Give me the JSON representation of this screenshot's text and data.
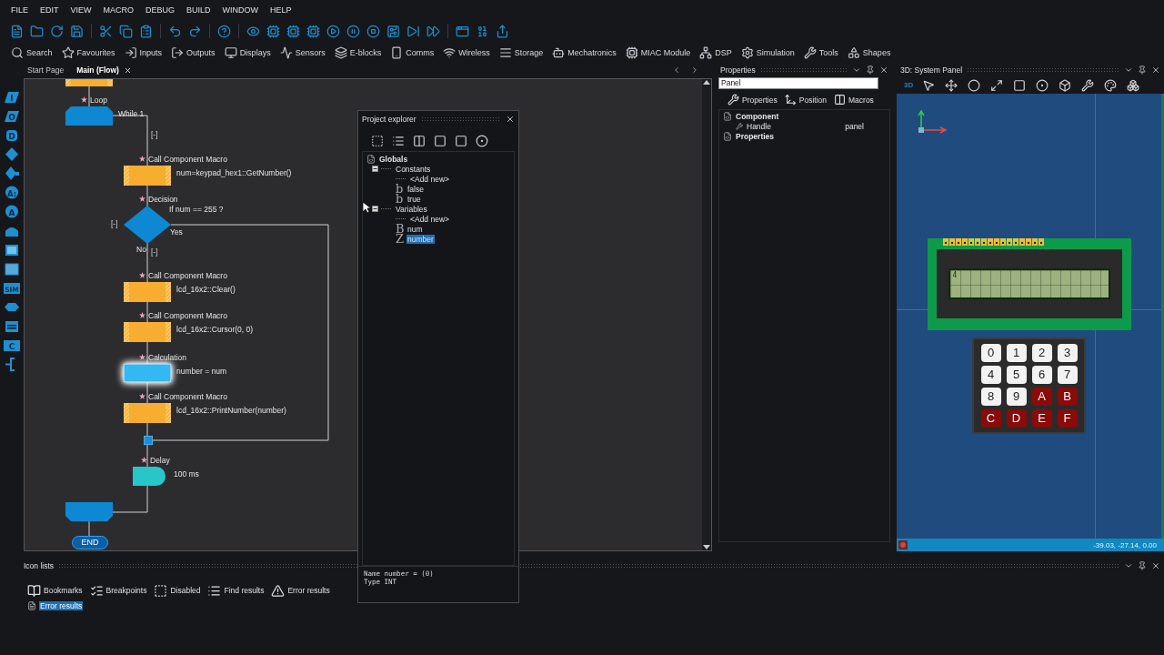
{
  "menu": [
    "FILE",
    "EDIT",
    "VIEW",
    "MACRO",
    "DEBUG",
    "BUILD",
    "WINDOW",
    "HELP"
  ],
  "component_toolbar": [
    {
      "label": "Search"
    },
    {
      "label": "Favourites"
    },
    {
      "label": "Inputs"
    },
    {
      "label": "Outputs"
    },
    {
      "label": "Displays"
    },
    {
      "label": "Sensors"
    },
    {
      "label": "E-blocks"
    },
    {
      "label": "Comms"
    },
    {
      "label": "Wireless"
    },
    {
      "label": "Storage"
    },
    {
      "label": "Mechatronics"
    },
    {
      "label": "MIAC Module"
    },
    {
      "label": "DSP"
    },
    {
      "label": "Simulation"
    },
    {
      "label": "Tools"
    },
    {
      "label": "Shapes"
    }
  ],
  "doc_tabs": [
    {
      "label": "Start Page",
      "selected": false
    },
    {
      "label": "Main (Flow)",
      "selected": true
    }
  ],
  "palette": [
    {
      "kind": "para",
      "glyph": "I"
    },
    {
      "kind": "para",
      "glyph": "O"
    },
    {
      "kind": "round",
      "glyph": "D"
    },
    {
      "kind": "diamond"
    },
    {
      "kind": "diamond_tail"
    },
    {
      "kind": "circle",
      "glyph": "A:"
    },
    {
      "kind": "circle",
      "glyph": "A"
    },
    {
      "kind": "dome"
    },
    {
      "kind": "bars"
    },
    {
      "kind": "hatched"
    },
    {
      "kind": "rect",
      "glyph": "SIM"
    },
    {
      "kind": "hex"
    },
    {
      "kind": "lines"
    },
    {
      "kind": "rect",
      "glyph": "C"
    },
    {
      "kind": "bracket"
    }
  ],
  "flowchart": {
    "nodes": [
      {
        "kind": "call",
        "selected": false
      },
      {
        "kind": "loop_start",
        "title": "Loop",
        "text": "While 1",
        "collapse": "[-]",
        "selected": false
      },
      {
        "kind": "call",
        "title": "Call Component Macro",
        "text": "num=keypad_hex1::GetNumber()",
        "selected": false
      },
      {
        "kind": "decision",
        "title": "Decision",
        "text": "If num == 255 ?",
        "yes": "Yes",
        "no": "No",
        "collapse_left": "[-]",
        "collapse_no": "[-]",
        "selected": false
      },
      {
        "kind": "call",
        "title": "Call Component Macro",
        "text": "lcd_16x2::Clear()",
        "selected": false
      },
      {
        "kind": "call",
        "title": "Call Component Macro",
        "text": "lcd_16x2::Cursor(0, 0)",
        "selected": false
      },
      {
        "kind": "calculation",
        "title": "Calculation",
        "text": "number = num",
        "selected": true
      },
      {
        "kind": "call",
        "title": "Call Component Macro",
        "text": "lcd_16x2::PrintNumber(number)",
        "selected": false
      },
      {
        "kind": "junction",
        "selected": false
      },
      {
        "kind": "delay",
        "title": "Delay",
        "text": "100 ms",
        "selected": false
      },
      {
        "kind": "loop_end",
        "selected": false
      },
      {
        "kind": "end",
        "label": "END",
        "selected": false
      }
    ]
  },
  "project_explorer": {
    "title": "Project explorer",
    "tree": [
      {
        "label": "Globals",
        "selected": false,
        "children": [
          {
            "label": "Constants",
            "expanded": true,
            "selected": false,
            "children": [
              {
                "label": "<Add new>",
                "selected": false
              },
              {
                "label": "false",
                "glyph": "b",
                "selected": false
              },
              {
                "label": "true",
                "glyph": "b",
                "selected": false
              }
            ]
          },
          {
            "label": "Variables",
            "expanded": true,
            "selected": false,
            "children": [
              {
                "label": "<Add new>",
                "selected": false
              },
              {
                "label": "num",
                "glyph": "B",
                "selected": false
              },
              {
                "label": "number",
                "glyph": "Z",
                "selected": true
              }
            ]
          }
        ]
      }
    ],
    "info": [
      "Name number = (0)",
      "Type INT"
    ]
  },
  "properties": {
    "title": "Properties",
    "search": "Panel",
    "tabs": [
      {
        "label": "Properties"
      },
      {
        "label": "Position"
      },
      {
        "label": "Macros"
      }
    ],
    "tree": [
      {
        "label": "Component",
        "children": [
          {
            "label": "Handle",
            "value": "panel"
          }
        ]
      },
      {
        "label": "Properties"
      }
    ]
  },
  "system_panel": {
    "title": "3D: System Panel",
    "mode_label": "3D",
    "lcd_text": "4",
    "keypad": [
      {
        "label": "0",
        "color": "#f2f2f2"
      },
      {
        "label": "1",
        "color": "#f2f2f2"
      },
      {
        "label": "2",
        "color": "#f2f2f2"
      },
      {
        "label": "3",
        "color": "#f2f2f2"
      },
      {
        "label": "4",
        "color": "#f2f2f2"
      },
      {
        "label": "5",
        "color": "#f2f2f2"
      },
      {
        "label": "6",
        "color": "#f2f2f2"
      },
      {
        "label": "7",
        "color": "#f2f2f2"
      },
      {
        "label": "8",
        "color": "#f2f2f2"
      },
      {
        "label": "9",
        "color": "#f2f2f2"
      },
      {
        "label": "A",
        "color": "#8b0a0a"
      },
      {
        "label": "B",
        "color": "#8b0a0a"
      },
      {
        "label": "C",
        "color": "#8b0a0a"
      },
      {
        "label": "D",
        "color": "#8b0a0a"
      },
      {
        "label": "E",
        "color": "#8b0a0a"
      },
      {
        "label": "F",
        "color": "#8b0a0a"
      }
    ],
    "status": "-39.03, -27.14, 0.00"
  },
  "icon_lists": {
    "title": "Icon lists",
    "tabs": [
      {
        "label": "Bookmarks"
      },
      {
        "label": "Breakpoints"
      },
      {
        "label": "Disabled"
      },
      {
        "label": "Find results"
      },
      {
        "label": "Error results"
      }
    ],
    "items": [
      {
        "label": "Error results",
        "selected": true
      }
    ]
  }
}
